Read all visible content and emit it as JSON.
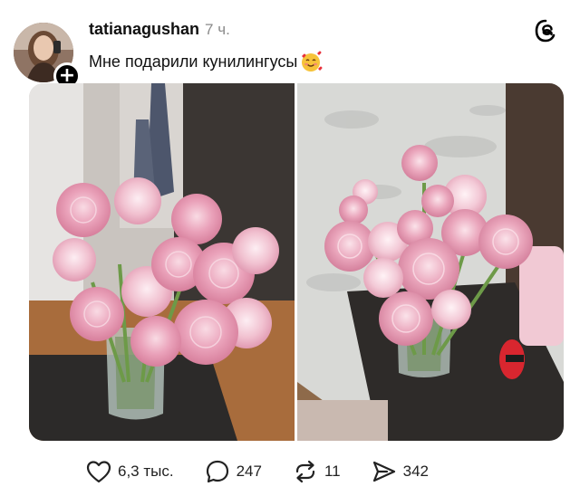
{
  "post": {
    "username": "tatianagushan",
    "timestamp": "7 ч.",
    "caption": "Мне подарили кунилингусы",
    "caption_emoji": "smiling-face-with-hearts-emoji",
    "follow_glyph": "+"
  },
  "photos": [
    {
      "subject": "pink ranunculus bouquet in glass vase"
    },
    {
      "subject": "pink ranunculus bouquet in glass vase on dark table"
    }
  ],
  "actions": {
    "likes": "6,3 тыс.",
    "comments": "247",
    "reposts": "11",
    "shares": "342"
  },
  "icons": {
    "like": "heart-icon",
    "comment": "comment-bubble-icon",
    "repost": "repost-arrows-icon",
    "share": "send-paper-plane-icon",
    "brand": "threads-logo-icon"
  },
  "colors": {
    "text": "#111111",
    "muted": "#8a8a8a",
    "flower_pink": "#e79ab3",
    "flower_light": "#f6d3de"
  }
}
